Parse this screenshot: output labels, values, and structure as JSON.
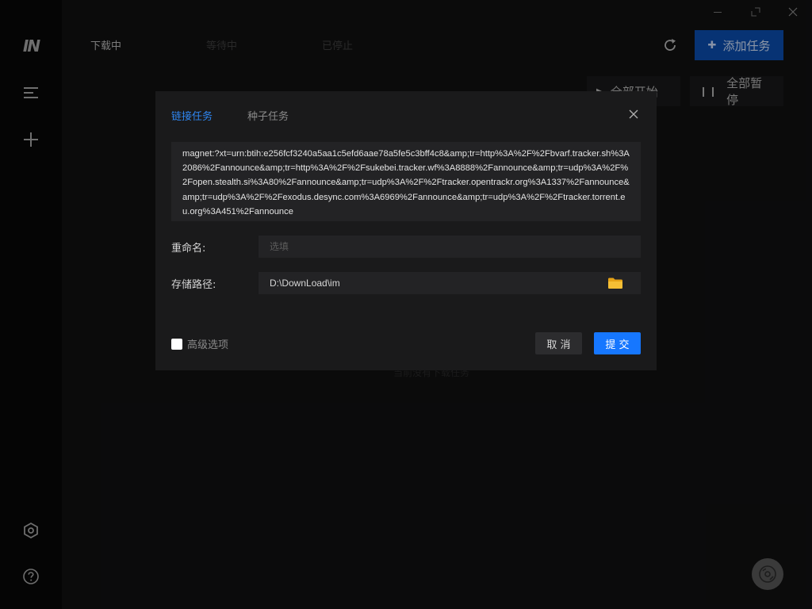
{
  "app": {
    "logo_text": "IN"
  },
  "header": {
    "tabs": [
      {
        "label": "下载中"
      },
      {
        "label": "等待中"
      },
      {
        "label": "已停止"
      }
    ],
    "add_task_label": "添加任务",
    "start_all_label": "全部开始",
    "pause_all_label": "全部暂停"
  },
  "main": {
    "empty_text": "当前没有下载任务"
  },
  "icons": {
    "sidebar": [
      "menu-icon",
      "plus-icon",
      "settings-hex-icon",
      "help-icon"
    ],
    "window": [
      "minimize-icon",
      "maximize-icon",
      "close-icon"
    ],
    "fab": "disc-icon",
    "folder": "folder-icon"
  },
  "colors": {
    "accent": "#1677ff",
    "add_button": "#0b4fb3",
    "active_tab": "#2f86f0",
    "folder": "#f2b01e"
  },
  "dialog": {
    "tabs": [
      {
        "label": "链接任务"
      },
      {
        "label": "种子任务"
      }
    ],
    "magnet": "magnet:?xt=urn:btih:e256fcf3240a5aa1c5efd6aae78a5fe5c3bff4c8&amp;tr=http%3A%2F%2Fbvarf.tracker.sh%3A2086%2Fannounce&amp;tr=http%3A%2F%2Fsukebei.tracker.wf%3A8888%2Fannounce&amp;tr=udp%3A%2F%2Fopen.stealth.si%3A80%2Fannounce&amp;tr=udp%3A%2F%2Ftracker.opentrackr.org%3A1337%2Fannounce&amp;tr=udp%3A%2F%2Fexodus.desync.com%3A6969%2Fannounce&amp;tr=udp%3A%2F%2Ftracker.torrent.eu.org%3A451%2Fannounce",
    "rename_label": "重命名:",
    "rename_value": "",
    "rename_placeholder": "选填",
    "path_label": "存储路径:",
    "path_value": "D:\\DownLoad\\im",
    "advanced_label": "高级选项",
    "cancel_label": "取 消",
    "submit_label": "提 交"
  }
}
